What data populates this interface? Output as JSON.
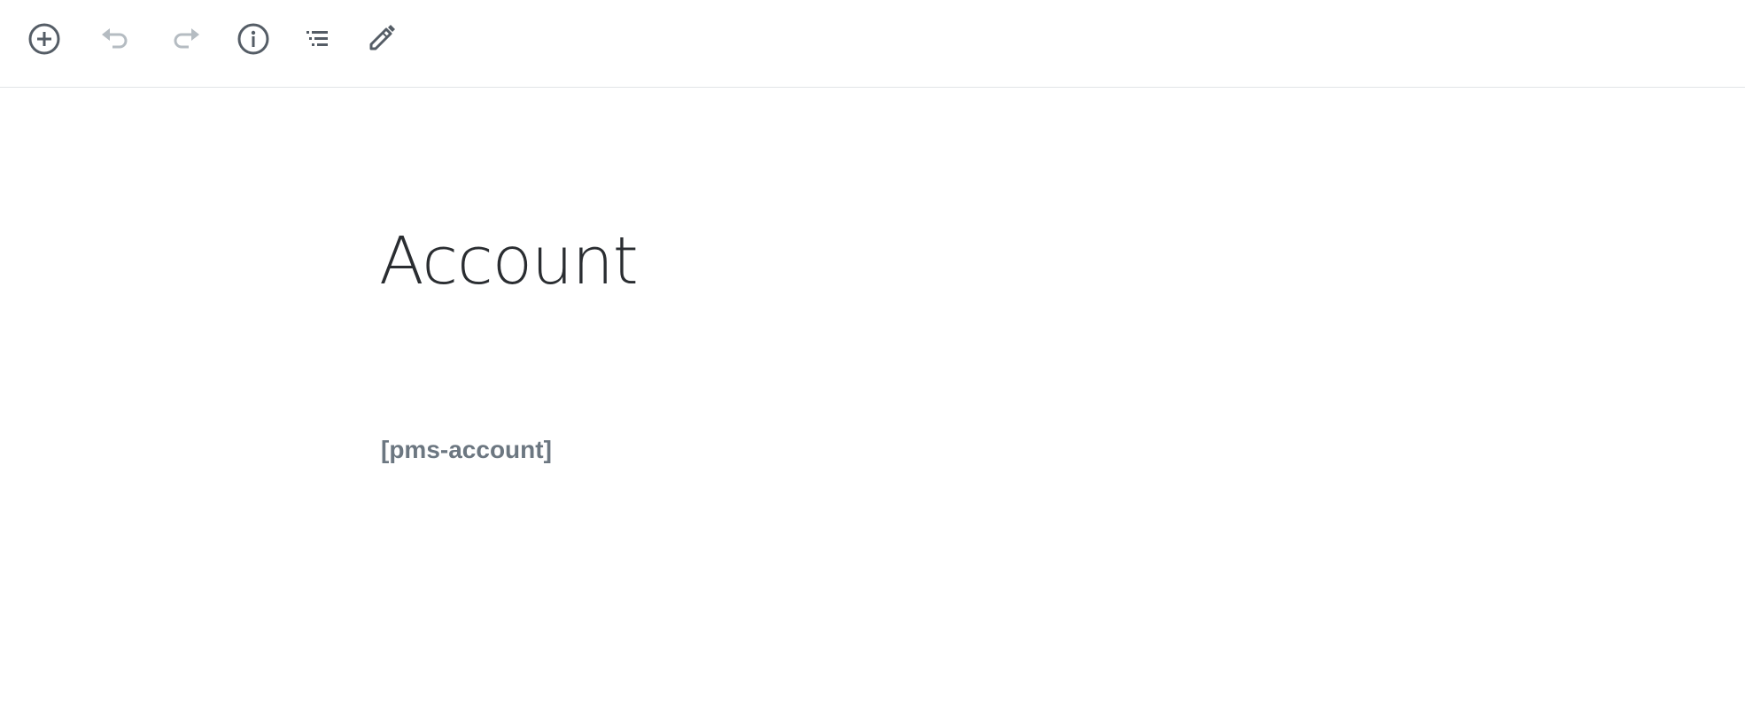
{
  "toolbar": {
    "add_block": {
      "icon": "plus-circle-icon",
      "enabled": true
    },
    "undo": {
      "icon": "undo-icon",
      "enabled": false
    },
    "redo": {
      "icon": "redo-icon",
      "enabled": false
    },
    "info": {
      "icon": "info-icon",
      "enabled": true
    },
    "outline": {
      "icon": "list-outline-icon",
      "enabled": true
    },
    "edit": {
      "icon": "pencil-icon",
      "enabled": true
    }
  },
  "colors": {
    "icon_active": "#555d66",
    "icon_disabled": "#b5bcc2",
    "title": "#2a2d31",
    "shortcode": "#6c7781",
    "divider": "#e2e4e7"
  },
  "post": {
    "title": "Account",
    "shortcode": "[pms-account]"
  }
}
